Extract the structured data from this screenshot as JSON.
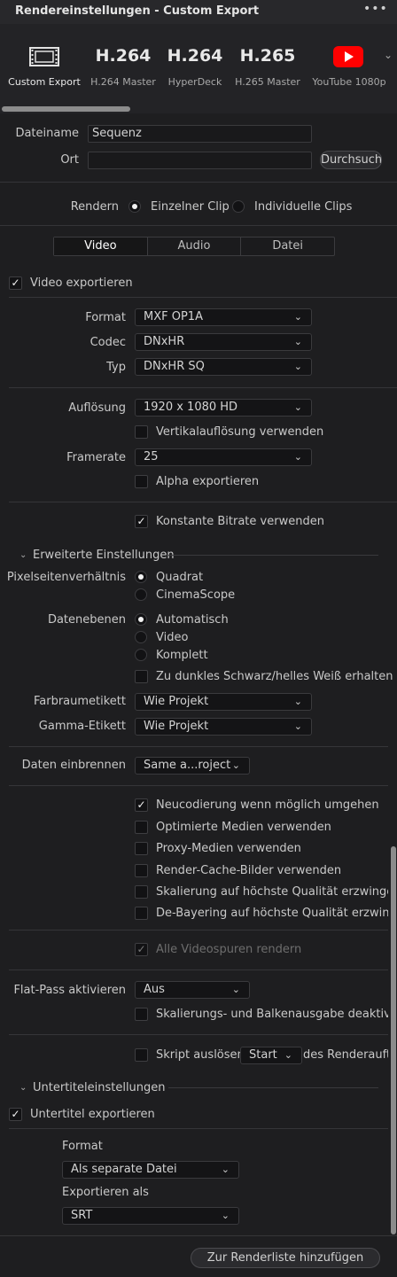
{
  "window": {
    "title": "Rendereinstellungen - Custom Export",
    "menu": "•••"
  },
  "presets": [
    {
      "icon": "film-icon",
      "label": "Custom Export"
    },
    {
      "icon": "H.264",
      "label": "H.264 Master"
    },
    {
      "icon": "H.264",
      "label": "HyperDeck"
    },
    {
      "icon": "H.265",
      "label": "H.265 Master"
    },
    {
      "icon": "youtube-icon",
      "label": "YouTube 1080p"
    }
  ],
  "file": {
    "name_label": "Dateiname",
    "name_value": "Sequenz",
    "location_label": "Ort",
    "location_value": "",
    "browse": "Durchsuchen"
  },
  "render": {
    "label": "Rendern",
    "single": "Einzelner Clip",
    "individual": "Individuelle Clips",
    "selected": "single"
  },
  "tabs": {
    "video": "Video",
    "audio": "Audio",
    "file": "Datei"
  },
  "video": {
    "export_label": "Video exportieren",
    "format_label": "Format",
    "format_value": "MXF OP1A",
    "codec_label": "Codec",
    "codec_value": "DNxHR",
    "type_label": "Typ",
    "type_value": "DNxHR SQ",
    "resolution_label": "Auflösung",
    "resolution_value": "1920 x 1080 HD",
    "vertical_res": "Vertikalauflösung verwenden",
    "framerate_label": "Framerate",
    "framerate_value": "25",
    "alpha": "Alpha exportieren",
    "const_bitrate": "Konstante Bitrate verwenden"
  },
  "advanced": {
    "title": "Erweiterte Einstellungen",
    "par_label": "Pixelseitenverhältnis",
    "par_square": "Quadrat",
    "par_cinemascope": "CinemaScope",
    "levels_label": "Datenebenen",
    "levels_auto": "Automatisch",
    "levels_video": "Video",
    "levels_full": "Komplett",
    "retain_superblack": "Zu dunkles Schwarz/helles Weiß erhalten",
    "colorspace_label": "Farbraumetikett",
    "colorspace_value": "Wie Projekt",
    "gamma_label": "Gamma-Etikett",
    "gamma_value": "Wie Projekt",
    "burnin_label": "Daten einbrennen",
    "burnin_value": "Same a...roject",
    "bypass_reencode": "Neucodierung wenn möglich umgehen",
    "optimized_media": "Optimierte Medien verwenden",
    "proxy_media": "Proxy-Medien verwenden",
    "render_cache": "Render-Cache-Bilder verwenden",
    "max_quality": "Skalierung auf höchste Qualität erzwingen",
    "debayer": "De-Bayering auf höchste Qualität erzwingen",
    "all_tracks": "Alle Videospuren rendern",
    "flatpass_label": "Flat-Pass aktivieren",
    "flatpass_value": "Aus",
    "disable_scaling": "Skalierungs- und Balkenausgabe deaktivieren",
    "script_label": "Skript auslösen",
    "script_value": "Start",
    "script_suffix": "des Renderauftrags"
  },
  "subtitles": {
    "title": "Untertiteleinstellungen",
    "export_label": "Untertitel exportieren",
    "format_label": "Format",
    "format_value": "Als separate Datei",
    "export_as_label": "Exportieren als",
    "export_as_value": "SRT"
  },
  "footer": {
    "add_to_queue": "Zur Renderliste hinzufügen"
  },
  "colors": {
    "youtube": "#ff0000",
    "background": "#1e1e20"
  }
}
